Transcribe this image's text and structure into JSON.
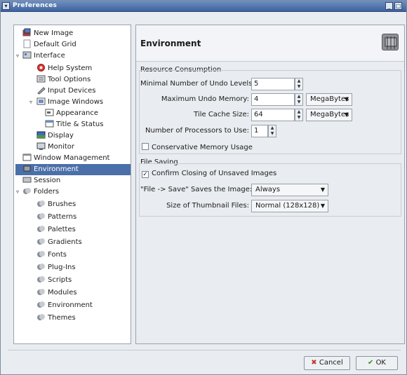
{
  "window": {
    "title": "Preferences"
  },
  "titlebar": {
    "minimize": "_",
    "maximize": "□",
    "close": "x"
  },
  "tree": {
    "items": [
      {
        "label": "New Image"
      },
      {
        "label": "Default Grid"
      },
      {
        "label": "Interface"
      },
      {
        "label": "Help System"
      },
      {
        "label": "Tool Options"
      },
      {
        "label": "Input Devices"
      },
      {
        "label": "Image Windows"
      },
      {
        "label": "Appearance"
      },
      {
        "label": "Title & Status"
      },
      {
        "label": "Display"
      },
      {
        "label": "Monitor"
      },
      {
        "label": "Window Management"
      },
      {
        "label": "Environment"
      },
      {
        "label": "Session"
      },
      {
        "label": "Folders"
      },
      {
        "label": "Brushes"
      },
      {
        "label": "Patterns"
      },
      {
        "label": "Palettes"
      },
      {
        "label": "Gradients"
      },
      {
        "label": "Fonts"
      },
      {
        "label": "Plug-Ins"
      },
      {
        "label": "Scripts"
      },
      {
        "label": "Modules"
      },
      {
        "label": "Environment"
      },
      {
        "label": "Themes"
      }
    ],
    "selected": "Environment"
  },
  "panel": {
    "title": "Environment",
    "resource": {
      "title": "Resource Consumption",
      "undo_levels_label": "Minimal Number of Undo Levels:",
      "undo_levels_value": "5",
      "undo_memory_label": "Maximum Undo Memory:",
      "undo_memory_value": "4",
      "undo_memory_unit": "MegaBytes",
      "tile_cache_label": "Tile Cache Size:",
      "tile_cache_value": "64",
      "tile_cache_unit": "MegaBytes",
      "processors_label": "Number of Processors to Use:",
      "processors_value": "1",
      "conservative_label": "Conservative Memory Usage",
      "conservative_checked": false
    },
    "file_saving": {
      "title": "File Saving",
      "confirm_label": "Confirm Closing of Unsaved Images",
      "confirm_checked": true,
      "save_label": "\"File -> Save\" Saves the Image:",
      "save_value": "Always",
      "thumb_label": "Size of Thumbnail Files:",
      "thumb_value": "Normal (128x128)"
    }
  },
  "buttons": {
    "cancel": "Cancel",
    "ok": "OK"
  },
  "colors": {
    "selection": "#4b6fa8",
    "titlebar": "#3d629e"
  }
}
